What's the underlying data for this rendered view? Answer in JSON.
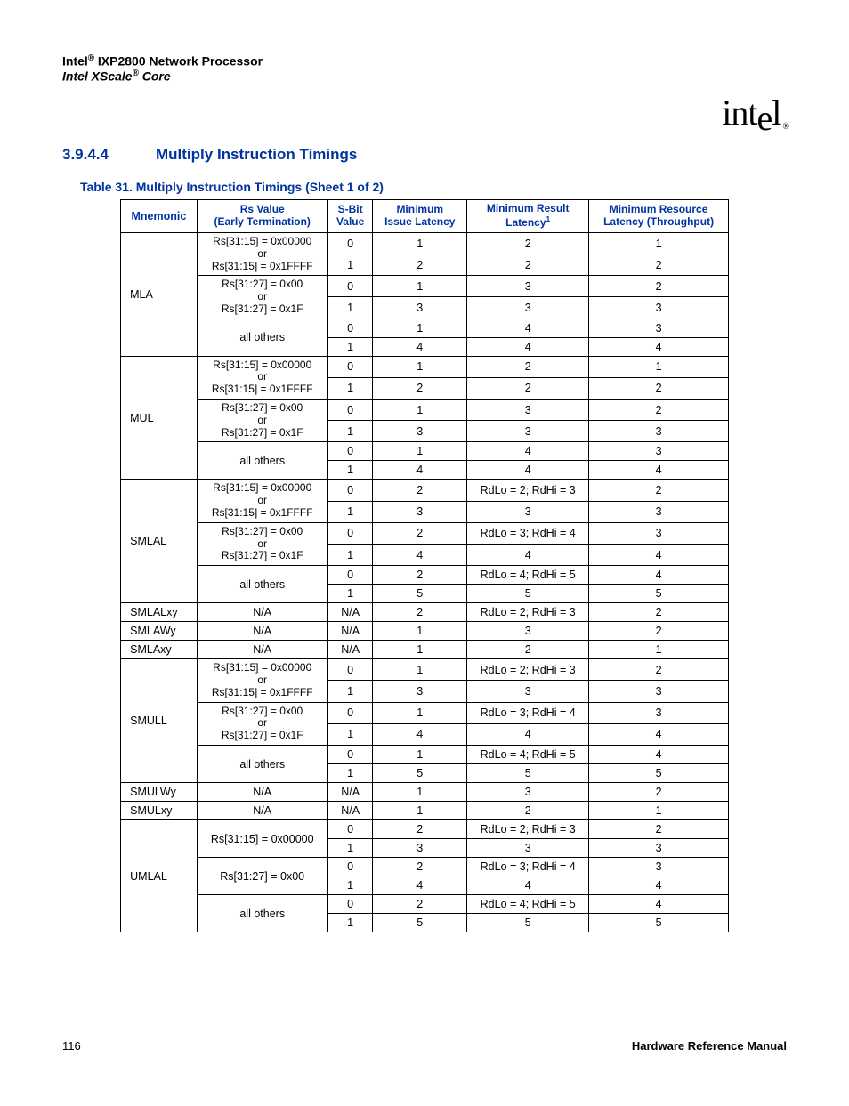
{
  "header": {
    "line1_pre": "Intel",
    "line1_post": " IXP2800 Network Processor",
    "line2_pre": "Intel XScale",
    "line2_post": " Core",
    "logo": "intel",
    "reg": "®"
  },
  "section": {
    "num": "3.9.4.4",
    "title": "Multiply Instruction Timings"
  },
  "table_caption": "Table 31.  Multiply Instruction Timings (Sheet 1 of 2)",
  "columns": {
    "c0": "Mnemonic",
    "c1a": "Rs Value",
    "c1b": "(Early Termination)",
    "c2a": "S-Bit",
    "c2b": "Value",
    "c3a": "Minimum",
    "c3b": "Issue Latency",
    "c4a": "Minimum Result",
    "c4b": "Latency",
    "c4sup": "1",
    "c5a": "Minimum Resource",
    "c5b": "Latency (Throughput)"
  },
  "rs": {
    "a_top": "Rs[31:15] = 0x00000",
    "a_mid": "or",
    "a_bot": "Rs[31:15] = 0x1FFFF",
    "b_top": "Rs[31:27] = 0x00",
    "b_mid": "or",
    "b_bot": "Rs[31:27] = 0x1F",
    "c": "all others",
    "d": "Rs[31:15] = 0x00000",
    "e": "Rs[31:27] = 0x00",
    "na": "N/A"
  },
  "groups": [
    {
      "mn": "MLA",
      "rows": [
        {
          "rs": "a",
          "s": "0",
          "il": "1",
          "rl": "2",
          "tl": "1"
        },
        {
          "rs": "",
          "s": "1",
          "il": "2",
          "rl": "2",
          "tl": "2"
        },
        {
          "rs": "b",
          "s": "0",
          "il": "1",
          "rl": "3",
          "tl": "2"
        },
        {
          "rs": "",
          "s": "1",
          "il": "3",
          "rl": "3",
          "tl": "3"
        },
        {
          "rs": "c",
          "s": "0",
          "il": "1",
          "rl": "4",
          "tl": "3"
        },
        {
          "rs": "",
          "s": "1",
          "il": "4",
          "rl": "4",
          "tl": "4"
        }
      ]
    },
    {
      "mn": "MUL",
      "rows": [
        {
          "rs": "a",
          "s": "0",
          "il": "1",
          "rl": "2",
          "tl": "1"
        },
        {
          "rs": "",
          "s": "1",
          "il": "2",
          "rl": "2",
          "tl": "2"
        },
        {
          "rs": "b",
          "s": "0",
          "il": "1",
          "rl": "3",
          "tl": "2"
        },
        {
          "rs": "",
          "s": "1",
          "il": "3",
          "rl": "3",
          "tl": "3"
        },
        {
          "rs": "c",
          "s": "0",
          "il": "1",
          "rl": "4",
          "tl": "3"
        },
        {
          "rs": "",
          "s": "1",
          "il": "4",
          "rl": "4",
          "tl": "4"
        }
      ]
    },
    {
      "mn": "SMLAL",
      "rows": [
        {
          "rs": "a",
          "s": "0",
          "il": "2",
          "rl": "RdLo = 2; RdHi = 3",
          "tl": "2"
        },
        {
          "rs": "",
          "s": "1",
          "il": "3",
          "rl": "3",
          "tl": "3"
        },
        {
          "rs": "b",
          "s": "0",
          "il": "2",
          "rl": "RdLo = 3; RdHi = 4",
          "tl": "3"
        },
        {
          "rs": "",
          "s": "1",
          "il": "4",
          "rl": "4",
          "tl": "4"
        },
        {
          "rs": "c",
          "s": "0",
          "il": "2",
          "rl": "RdLo = 4; RdHi = 5",
          "tl": "4"
        },
        {
          "rs": "",
          "s": "1",
          "il": "5",
          "rl": "5",
          "tl": "5"
        }
      ]
    },
    {
      "mn": "SMLALxy",
      "rows": [
        {
          "rs": "na",
          "s": "N/A",
          "il": "2",
          "rl": "RdLo = 2; RdHi = 3",
          "tl": "2"
        }
      ]
    },
    {
      "mn": "SMLAWy",
      "rows": [
        {
          "rs": "na",
          "s": "N/A",
          "il": "1",
          "rl": "3",
          "tl": "2"
        }
      ]
    },
    {
      "mn": "SMLAxy",
      "rows": [
        {
          "rs": "na",
          "s": "N/A",
          "il": "1",
          "rl": "2",
          "tl": "1"
        }
      ]
    },
    {
      "mn": "SMULL",
      "rows": [
        {
          "rs": "a",
          "s": "0",
          "il": "1",
          "rl": "RdLo = 2; RdHi = 3",
          "tl": "2"
        },
        {
          "rs": "",
          "s": "1",
          "il": "3",
          "rl": "3",
          "tl": "3"
        },
        {
          "rs": "b",
          "s": "0",
          "il": "1",
          "rl": "RdLo = 3; RdHi = 4",
          "tl": "3"
        },
        {
          "rs": "",
          "s": "1",
          "il": "4",
          "rl": "4",
          "tl": "4"
        },
        {
          "rs": "c",
          "s": "0",
          "il": "1",
          "rl": "RdLo = 4; RdHi = 5",
          "tl": "4"
        },
        {
          "rs": "",
          "s": "1",
          "il": "5",
          "rl": "5",
          "tl": "5"
        }
      ]
    },
    {
      "mn": "SMULWy",
      "rows": [
        {
          "rs": "na",
          "s": "N/A",
          "il": "1",
          "rl": "3",
          "tl": "2"
        }
      ]
    },
    {
      "mn": "SMULxy",
      "rows": [
        {
          "rs": "na",
          "s": "N/A",
          "il": "1",
          "rl": "2",
          "tl": "1"
        }
      ]
    },
    {
      "mn": "UMLAL",
      "rows": [
        {
          "rs": "d",
          "s": "0",
          "il": "2",
          "rl": "RdLo = 2; RdHi = 3",
          "tl": "2"
        },
        {
          "rs": "",
          "s": "1",
          "il": "3",
          "rl": "3",
          "tl": "3"
        },
        {
          "rs": "e",
          "s": "0",
          "il": "2",
          "rl": "RdLo = 3; RdHi = 4",
          "tl": "3"
        },
        {
          "rs": "",
          "s": "1",
          "il": "4",
          "rl": "4",
          "tl": "4"
        },
        {
          "rs": "c",
          "s": "0",
          "il": "2",
          "rl": "RdLo = 4; RdHi = 5",
          "tl": "4"
        },
        {
          "rs": "",
          "s": "1",
          "il": "5",
          "rl": "5",
          "tl": "5"
        }
      ]
    }
  ],
  "footer": {
    "page": "116",
    "manual": "Hardware Reference Manual"
  }
}
